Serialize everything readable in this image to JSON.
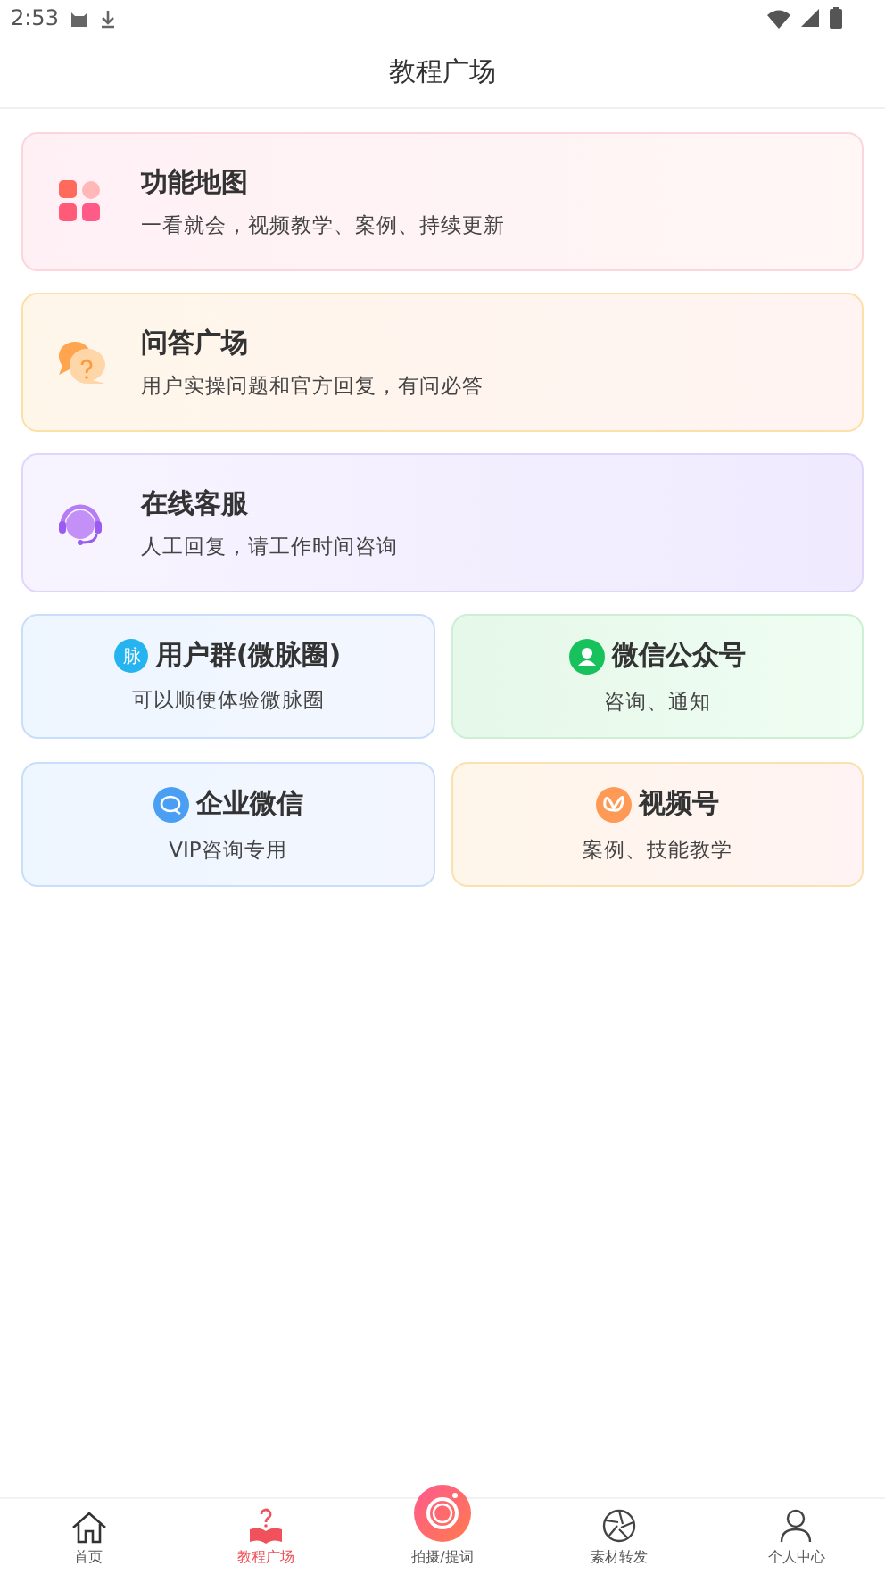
{
  "status_bar": {
    "time": "2:53"
  },
  "header": {
    "title": "教程广场"
  },
  "cards": [
    {
      "kind": "wide",
      "title": "功能地图",
      "subtitle": "一看就会，视频教学、案例、持续更新"
    },
    {
      "kind": "wide",
      "title": "问答广场",
      "subtitle": "用户实操问题和官方回复，有问必答"
    },
    {
      "kind": "wide",
      "title": "在线客服",
      "subtitle": "人工回复，请工作时间咨询"
    },
    {
      "kind": "tile",
      "icon_text": "脉",
      "title": "用户群(微脉圈)",
      "subtitle": "可以顺便体验微脉圈"
    },
    {
      "kind": "tile",
      "title": "微信公众号",
      "subtitle": "咨询、通知"
    },
    {
      "kind": "tile",
      "title": "企业微信",
      "subtitle": "VIP咨询专用"
    },
    {
      "kind": "tile",
      "title": "视频号",
      "subtitle": "案例、技能教学"
    }
  ],
  "tab_bar": [
    {
      "label": "首页",
      "selected": false
    },
    {
      "label": "教程广场",
      "selected": true
    },
    {
      "label": "拍摄/提词",
      "selected": false
    },
    {
      "label": "素材转发",
      "selected": false
    },
    {
      "label": "个人中心",
      "selected": false
    }
  ]
}
